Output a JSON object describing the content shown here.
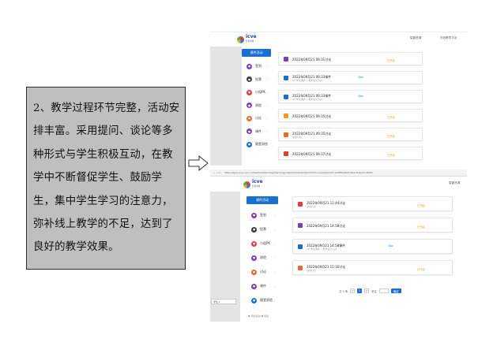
{
  "description_text": "2、教学过程环节完整，活动安排丰富。采用提问、谈论等多种形式与学生积极互动，在教学中不断督促学生、鼓励学生，集中学生学习的注意力，弥补线上教学的不足，达到了良好的教学效果。",
  "colors": {
    "accent": "#1a6fd1",
    "warning": "#f39c12",
    "file": "#2a7fd4"
  },
  "screenshot_top": {
    "top_right_1": "智能资源",
    "top_right_2": "在线教学平台",
    "sidebar_header": "课件活动",
    "sidebar_items": [
      {
        "label": "签到",
        "icon": "checkin-icon",
        "color": "#7b3fb5"
      },
      {
        "label": "投票",
        "icon": "vote-icon",
        "color": "#3a3a3a"
      },
      {
        "label": "小组PK",
        "icon": "pk-icon",
        "color": "#e23c3c"
      },
      {
        "label": "测验",
        "icon": "quiz-icon",
        "color": "#7b3fb5"
      },
      {
        "label": "讨论",
        "icon": "discuss-icon",
        "color": "#e86b2c"
      },
      {
        "label": "课件",
        "icon": "courseware-icon",
        "color": "#7b3fb5"
      },
      {
        "label": "随堂测验",
        "icon": "test-icon",
        "color": "#1a6fd1"
      }
    ],
    "records": [
      {
        "title": "2022年09月21 09:31讨论",
        "sub": "",
        "status": "已开启",
        "file": "",
        "icon_color": "#7b3fb5"
      },
      {
        "title": "2022年09月21 09:33课件",
        "sub": "02 学生课件 • 教学设计 ppt",
        "status": "",
        "file": "Doc",
        "icon_color": "#1a6fd1"
      },
      {
        "title": "2022年09月21 09:33课件",
        "sub": "03 学生课件 • 教学设计 ppt",
        "status": "",
        "file": "Doc",
        "icon_color": "#1a6fd1"
      },
      {
        "title": "2022年09月21 09:35讨论",
        "sub": "",
        "status": "已开启",
        "file": "",
        "icon_color": "#f39c12"
      },
      {
        "title": "2022年09月21 09:35讨论",
        "sub": "活动讨论",
        "status": "已开启",
        "file": "",
        "icon_color": "#e86b2c"
      },
      {
        "title": "2022年09月21 09:37讨论",
        "sub": "",
        "status": "已开启",
        "file": "",
        "icon_color": "#e23c3c"
      }
    ]
  },
  "screenshot_bottom": {
    "url": "https://zjy2.icve.com.cn/teacher/teaching/teaching/class/checkin/index.html?courseOpenId=10d8f0a8e5c9&activityId=8b0fc",
    "top_right": "智能资源",
    "sidebar_header": "课件活动",
    "sidebar_items": [
      {
        "label": "签到",
        "icon": "checkin-icon",
        "color": "#7b3fb5"
      },
      {
        "label": "投票",
        "icon": "vote-icon",
        "color": "#3a3a3a"
      },
      {
        "label": "小组PK",
        "icon": "pk-icon",
        "color": "#e23c3c"
      },
      {
        "label": "测验",
        "icon": "quiz-icon",
        "color": "#7b3fb5"
      },
      {
        "label": "讨论",
        "icon": "discuss-icon",
        "color": "#e86b2c"
      },
      {
        "label": "课件",
        "icon": "courseware-icon",
        "color": "#7b3fb5"
      },
      {
        "label": "随堂测验",
        "icon": "test-icon",
        "color": "#1a6fd1"
      }
    ],
    "sidebar_footer": "❶ 添加活动 ❷ 导出",
    "left_strip_label": "学生 ▾",
    "records": [
      {
        "title": "2022年09月21 11:44讨论",
        "sub": "活动讨论",
        "status": "已开启",
        "file": "",
        "icon_color": "#e23c3c"
      },
      {
        "title": "2022年09月21 14:58讨论",
        "sub": "",
        "status": "已开启",
        "file": "",
        "icon_color": "#7b3fb5"
      },
      {
        "title": "2022年09月21 14:58课件",
        "sub": "04 学生课件 • 教学设计 ppt",
        "status": "",
        "file": "Doc",
        "icon_color": "#1a6fd1"
      },
      {
        "title": "2022年09月21 15:16讨论",
        "sub": "活动讨论",
        "status": "已开启",
        "file": "",
        "icon_color": "#e86b2c"
      }
    ],
    "pager": {
      "total": "共 4 条",
      "prev": "<",
      "page": "1",
      "next": ">",
      "goto": "前往",
      "go": "确定"
    }
  }
}
